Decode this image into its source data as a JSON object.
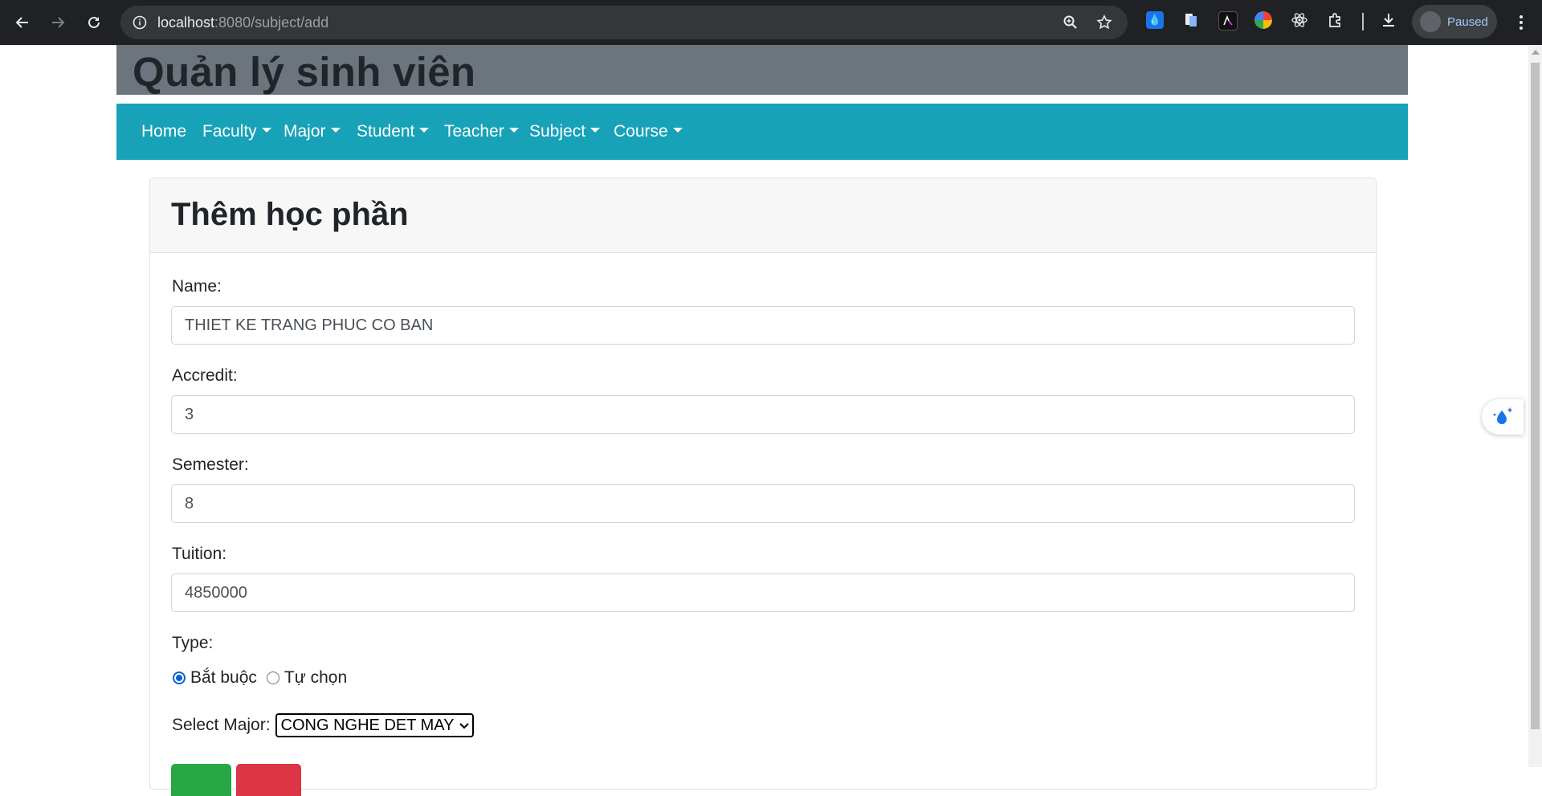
{
  "browser": {
    "url_host": "localhost",
    "url_path": ":8080/subject/add",
    "profile_label": "Paused",
    "icons": [
      "back-arrow-icon",
      "forward-arrow-icon",
      "reload-icon",
      "site-info-icon",
      "zoom-icon",
      "bookmark-star-icon",
      "extensions-icon",
      "download-icon",
      "menu-dots-icon"
    ]
  },
  "header": {
    "title": "Quản lý sinh viên",
    "background": "#6c757d"
  },
  "navbar": {
    "background": "#17a2b8",
    "items": [
      {
        "label": "Home",
        "dropdown": false
      },
      {
        "label": "Faculty",
        "dropdown": true
      },
      {
        "label": "Major",
        "dropdown": true
      },
      {
        "label": "Student",
        "dropdown": true
      },
      {
        "label": "Teacher",
        "dropdown": true
      },
      {
        "label": "Subject",
        "dropdown": true
      },
      {
        "label": "Course",
        "dropdown": true
      }
    ]
  },
  "form": {
    "title": "Thêm học phần",
    "name_label": "Name:",
    "name_value": "THIET KE TRANG PHUC CO BAN",
    "accredit_label": "Accredit:",
    "accredit_value": "3",
    "semester_label": "Semester:",
    "semester_value": "8",
    "tuition_label": "Tuition:",
    "tuition_value": "4850000",
    "type_label": "Type:",
    "type_options": [
      {
        "label": "Bắt buộc",
        "checked": true
      },
      {
        "label": "Tự chọn",
        "checked": false
      }
    ],
    "major_label": "Select Major:",
    "major_selected": "CONG NGHE DET MAY",
    "submit_color": "#28a745",
    "cancel_color": "#dc3545"
  }
}
